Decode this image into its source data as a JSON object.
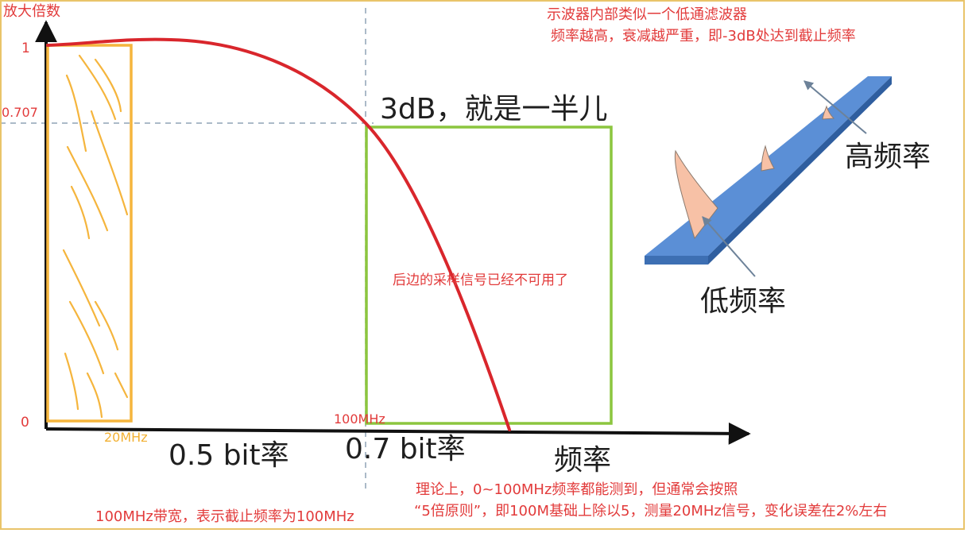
{
  "axes": {
    "y_title": "放大倍数",
    "x_title": "频率",
    "y_tick_top": "1",
    "y_tick_mid": "0.707",
    "y_tick_zero": "0",
    "x_label_20": "20MHz",
    "x_label_100": "100MHz",
    "x_region_low": "0.5 bit率",
    "x_region_high": "0.7 bit率"
  },
  "annotations": {
    "cutoff_label": "3dB，就是一半儿",
    "header_line1": "示波器内部类似一个低通滤波器",
    "header_line2": "频率越高，衰减越严重，即-3dB处达到截止频率",
    "unusable_note": "后边的采样信号已经不可用了",
    "theory_line1": "理论上，0~100MHz频率都能测到，但通常会按照",
    "theory_line2": "“5倍原则”，即100M基础上除以5，测量20MHz信号，变化误差在2%左右",
    "bandwidth_note": "100MHz带宽，表示截止频率为100MHz"
  },
  "filter_illustration": {
    "high_freq_label": "高频率",
    "low_freq_label": "低频率"
  },
  "colors": {
    "curve": "#d9262c",
    "text_red": "#e23b3b",
    "orange_box": "#f5b53d",
    "green_box": "#8cc63f",
    "guide_dash": "#8fa3b5",
    "plate": "#5b8fd6",
    "plate_edge": "#3d6fb3",
    "lobe": "#f7c1a6"
  }
}
